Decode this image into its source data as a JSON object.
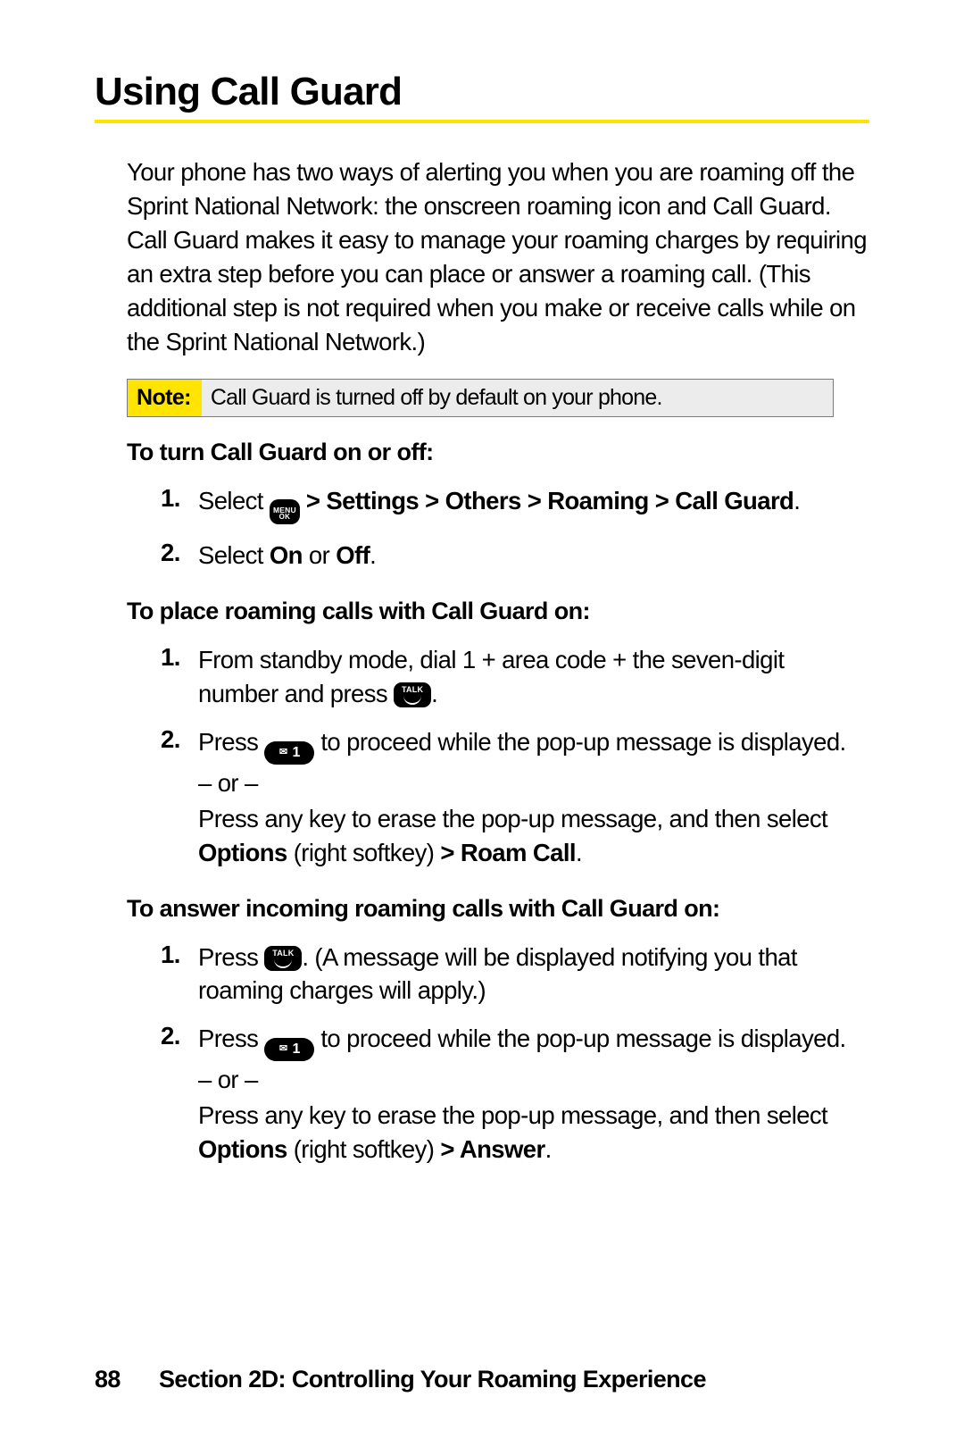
{
  "heading": "Using Call Guard",
  "intro": "Your phone has two ways of alerting you when you are roaming off the Sprint National Network: the onscreen roaming icon and Call Guard. Call Guard makes it easy to manage your roaming charges by requiring an extra step before you can place or answer a roaming call. (This additional step is not required when you make or receive calls while on the Sprint National Network.)",
  "note": {
    "label": "Note:",
    "body": "Call Guard is turned off by default on your phone."
  },
  "sectionA": {
    "title": "To turn Call Guard on or off:",
    "steps": {
      "s1": {
        "num": "1.",
        "pre": "Select ",
        "path": " > Settings > Others > Roaming > Call Guard",
        "post": "."
      },
      "s2": {
        "num": "2.",
        "pre": "Select ",
        "on": "On",
        "mid": " or ",
        "off": "Off",
        "post": "."
      }
    }
  },
  "sectionB": {
    "title": "To place roaming calls with Call Guard on:",
    "steps": {
      "s1": {
        "num": "1.",
        "pre": "From standby mode, dial 1 + area code + the seven-digit number and press ",
        "post": "."
      },
      "s2": {
        "num": "2.",
        "pre": "Press ",
        "mid": " to proceed while the pop-up message is displayed.",
        "or": "– or –",
        "alt_a": "Press any key to erase the pop-up message, and then select ",
        "alt_b": "Options",
        "alt_c": " (right softkey) ",
        "alt_d": "> Roam Call",
        "alt_e": "."
      }
    }
  },
  "sectionC": {
    "title": "To answer incoming roaming calls with Call Guard on:",
    "steps": {
      "s1": {
        "num": "1.",
        "pre": "Press ",
        "post": ". (A message will be displayed notifying you that roaming charges will apply.)"
      },
      "s2": {
        "num": "2.",
        "pre": "Press ",
        "mid": " to proceed while the pop-up message is displayed.",
        "or": "– or –",
        "alt_a": "Press any key to erase the pop-up message, and then select ",
        "alt_b": "Options",
        "alt_c": " (right softkey) ",
        "alt_d": "> Answer",
        "alt_e": "."
      }
    }
  },
  "icons": {
    "menu_top": "MENU",
    "menu_bot": "OK",
    "talk": "TALK",
    "one_digit": "1",
    "one_env": "✉"
  },
  "footer": {
    "page": "88",
    "text": "Section 2D: Controlling Your Roaming Experience"
  }
}
